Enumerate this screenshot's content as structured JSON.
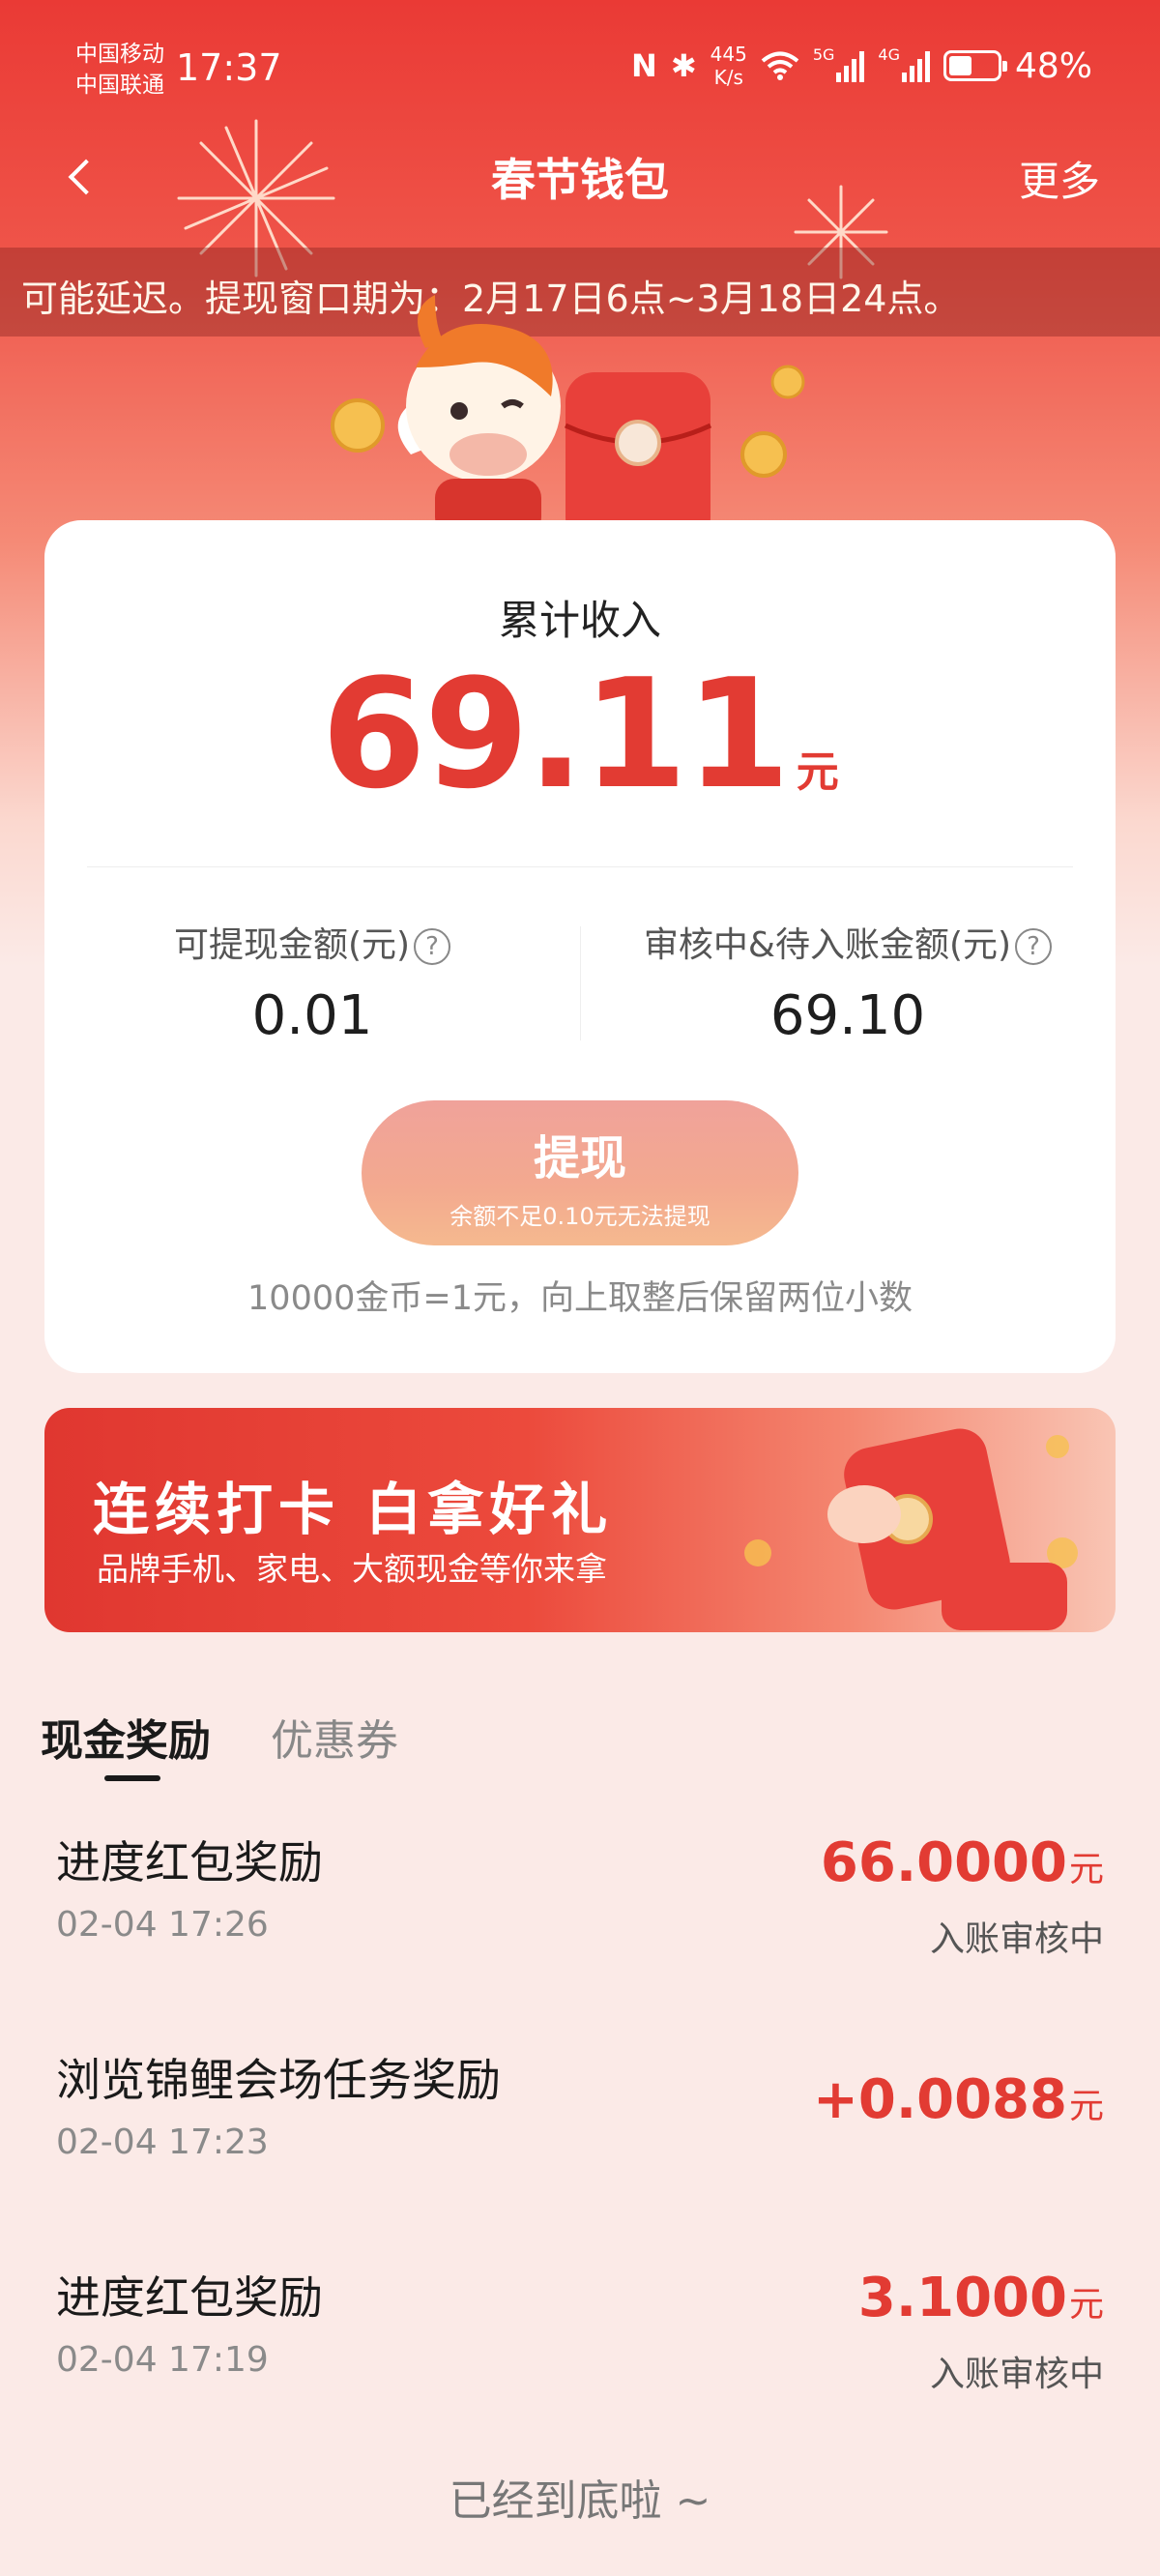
{
  "status_bar": {
    "carrier_1": "中国移动",
    "carrier_2": "中国联通",
    "time": "17:37",
    "nfc": "N",
    "bluetooth": "✱",
    "speed_value": "445",
    "speed_unit": "K/s",
    "net_5g": "5G",
    "net_4g": "4G",
    "battery_level": 0.48,
    "battery_text": "48%"
  },
  "nav": {
    "title": "春节钱包",
    "more": "更多"
  },
  "marquee": "可能延迟。提现窗口期为：2月17日6点~3月18日24点。",
  "summary": {
    "total_label": "累计收入",
    "total_value": "69.11",
    "total_unit": "元",
    "withdrawable_label": "可提现金额(元)",
    "withdrawable_value": "0.01",
    "pending_label": "审核中&待入账金额(元)",
    "pending_value": "69.10",
    "help_icon": "?",
    "withdraw_button": "提现",
    "withdraw_hint": "余额不足0.10元无法提现",
    "rate_note": "10000金币=1元，向上取整后保留两位小数"
  },
  "banner": {
    "title": "连续打卡 白拿好礼",
    "subtitle": "品牌手机、家电、大额现金等你来拿"
  },
  "tabs": {
    "cash": "现金奖励",
    "coupon": "优惠券"
  },
  "records": [
    {
      "title": "进度红包奖励",
      "time": "02-04 17:26",
      "amount": "66.0000",
      "unit": "元",
      "status": "入账审核中"
    },
    {
      "title": "浏览锦鲤会场任务奖励",
      "time": "02-04 17:23",
      "amount": "+0.0088",
      "unit": "元",
      "status": ""
    },
    {
      "title": "进度红包奖励",
      "time": "02-04 17:19",
      "amount": "3.1000",
      "unit": "元",
      "status": "入账审核中"
    }
  ],
  "end_note": "已经到底啦 ~",
  "colors": {
    "brand_red": "#e23b33",
    "header_red": "#ea3a35",
    "page_bg": "#fbeae7"
  }
}
